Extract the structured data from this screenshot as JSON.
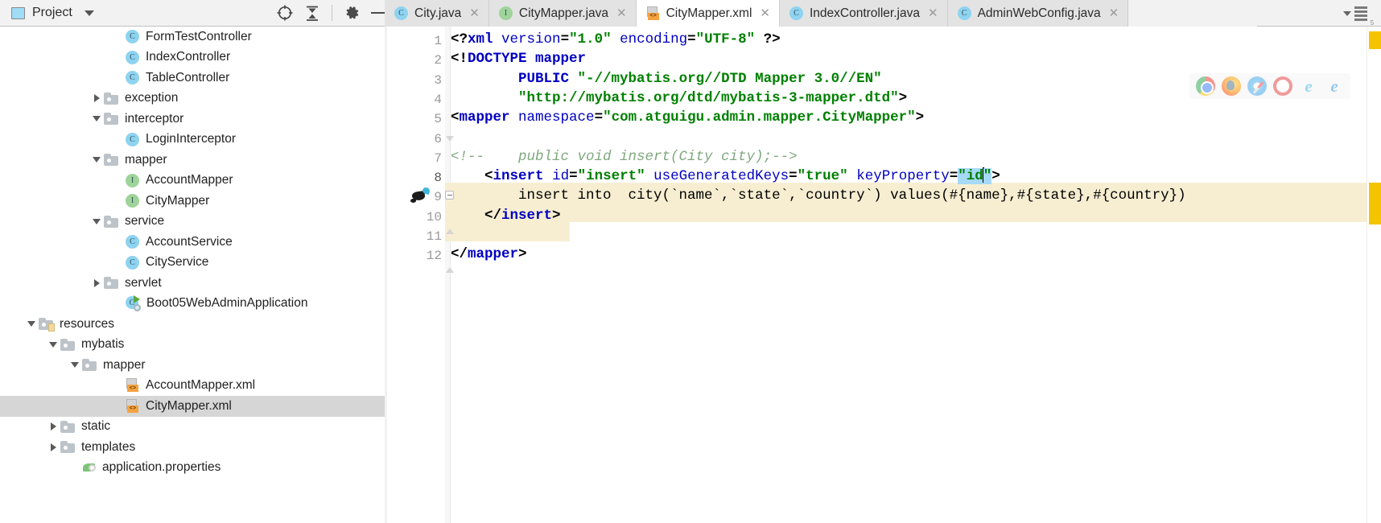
{
  "topbar": {
    "project_label": "Project",
    "project_icon": "project-window-icon",
    "dropdown_icon": "chevron-down-icon",
    "icons": [
      {
        "name": "locate-target-icon",
        "glyph": "target"
      },
      {
        "name": "collapse-all-icon",
        "glyph": "collapse"
      },
      {
        "name": "settings-gear-icon",
        "glyph": "gear"
      },
      {
        "name": "hide-panel-icon",
        "glyph": "minus"
      }
    ],
    "right_menu_icon": "editor-options-burger-icon",
    "right_menu_badge": "5"
  },
  "tabs": [
    {
      "label": "City.java",
      "icon": "java-class-icon",
      "icon_kind": "class",
      "active": false,
      "close_icon": "close-icon"
    },
    {
      "label": "CityMapper.java",
      "icon": "java-interface-icon",
      "icon_kind": "interface",
      "active": false,
      "close_icon": "close-icon"
    },
    {
      "label": "CityMapper.xml",
      "icon": "xml-file-icon",
      "icon_kind": "xml",
      "active": true,
      "close_icon": "close-icon"
    },
    {
      "label": "IndexController.java",
      "icon": "java-class-icon",
      "icon_kind": "class",
      "active": false,
      "close_icon": "close-icon"
    },
    {
      "label": "AdminWebConfig.java",
      "icon": "java-class-icon",
      "icon_kind": "class",
      "active": false,
      "close_icon": "close-icon"
    }
  ],
  "tab_icon_letters": {
    "class": "C",
    "interface": "I",
    "xml": "<>"
  },
  "project_tree": [
    {
      "label": "FormTestController",
      "indent": 6,
      "toggle": "none",
      "icon": "java-class-icon",
      "selected": false
    },
    {
      "label": "IndexController",
      "indent": 6,
      "toggle": "none",
      "icon": "java-class-icon",
      "selected": false
    },
    {
      "label": "TableController",
      "indent": 6,
      "toggle": "none",
      "icon": "java-class-icon",
      "selected": false
    },
    {
      "label": "exception",
      "indent": 5,
      "toggle": "collapsed",
      "icon": "folder-icon",
      "selected": false
    },
    {
      "label": "interceptor",
      "indent": 5,
      "toggle": "expanded",
      "icon": "folder-icon",
      "selected": false
    },
    {
      "label": "LoginInterceptor",
      "indent": 6,
      "toggle": "none",
      "icon": "java-class-icon",
      "selected": false
    },
    {
      "label": "mapper",
      "indent": 5,
      "toggle": "expanded",
      "icon": "folder-icon",
      "selected": false
    },
    {
      "label": "AccountMapper",
      "indent": 6,
      "toggle": "none",
      "icon": "java-interface-icon",
      "selected": false
    },
    {
      "label": "CityMapper",
      "indent": 6,
      "toggle": "none",
      "icon": "java-interface-icon",
      "selected": false
    },
    {
      "label": "service",
      "indent": 5,
      "toggle": "expanded",
      "icon": "folder-icon",
      "selected": false
    },
    {
      "label": "AccountService",
      "indent": 6,
      "toggle": "none",
      "icon": "java-class-icon",
      "selected": false
    },
    {
      "label": "CityService",
      "indent": 6,
      "toggle": "none",
      "icon": "java-class-icon",
      "selected": false
    },
    {
      "label": "servlet",
      "indent": 5,
      "toggle": "collapsed",
      "icon": "folder-icon",
      "selected": false
    },
    {
      "label": "Boot05WebAdminApplication",
      "indent": 6,
      "toggle": "none",
      "icon": "spring-boot-app-icon",
      "selected": false
    },
    {
      "label": "resources",
      "indent": 2,
      "toggle": "expanded",
      "icon": "resources-folder-icon",
      "selected": false
    },
    {
      "label": "mybatis",
      "indent": 3,
      "toggle": "expanded",
      "icon": "folder-icon",
      "selected": false
    },
    {
      "label": "mapper",
      "indent": 4,
      "toggle": "expanded",
      "icon": "folder-icon",
      "selected": false
    },
    {
      "label": "AccountMapper.xml",
      "indent": 6,
      "toggle": "none",
      "icon": "xml-file-icon",
      "selected": false
    },
    {
      "label": "CityMapper.xml",
      "indent": 6,
      "toggle": "none",
      "icon": "xml-file-icon",
      "selected": true
    },
    {
      "label": "static",
      "indent": 3,
      "toggle": "collapsed",
      "icon": "folder-icon",
      "selected": false
    },
    {
      "label": "templates",
      "indent": 3,
      "toggle": "collapsed",
      "icon": "folder-icon",
      "selected": false
    },
    {
      "label": "application.properties",
      "indent": 4,
      "toggle": "none",
      "icon": "spring-properties-icon",
      "selected": false
    }
  ],
  "editor": {
    "file": "CityMapper.xml",
    "line_numbers": [
      "1",
      "2",
      "3",
      "4",
      "5",
      "6",
      "7",
      "8",
      "9",
      "10",
      "11",
      "12"
    ],
    "current_line": "8",
    "selection_text": "id",
    "lines_plain": [
      "<?xml version=\"1.0\" encoding=\"UTF-8\" ?>",
      "<!DOCTYPE mapper",
      "        PUBLIC \"-//mybatis.org//DTD Mapper 3.0//EN\"",
      "        \"http://mybatis.org/dtd/mybatis-3-mapper.dtd\">",
      "<mapper namespace=\"com.atguigu.admin.mapper.CityMapper\">",
      "",
      "<!--    public void insert(City city);-->",
      "    <insert id=\"insert\" useGeneratedKeys=\"true\" keyProperty=\"id\">",
      "        insert into  city(`name`,`state`,`country`) values(#{name},#{state},#{country})",
      "    </insert>",
      "",
      "</mapper>"
    ],
    "gutter_icon_line8": "mybatis-navigate-icon",
    "browsers": [
      {
        "name": "chrome-icon",
        "cls": "chrome"
      },
      {
        "name": "firefox-icon",
        "cls": "firefox"
      },
      {
        "name": "safari-icon",
        "cls": "safari"
      },
      {
        "name": "opera-icon",
        "cls": "opera"
      },
      {
        "name": "internet-explorer-icon",
        "cls": "ie",
        "glyph": "e"
      },
      {
        "name": "edge-icon",
        "cls": "edge",
        "glyph": "e"
      }
    ]
  }
}
